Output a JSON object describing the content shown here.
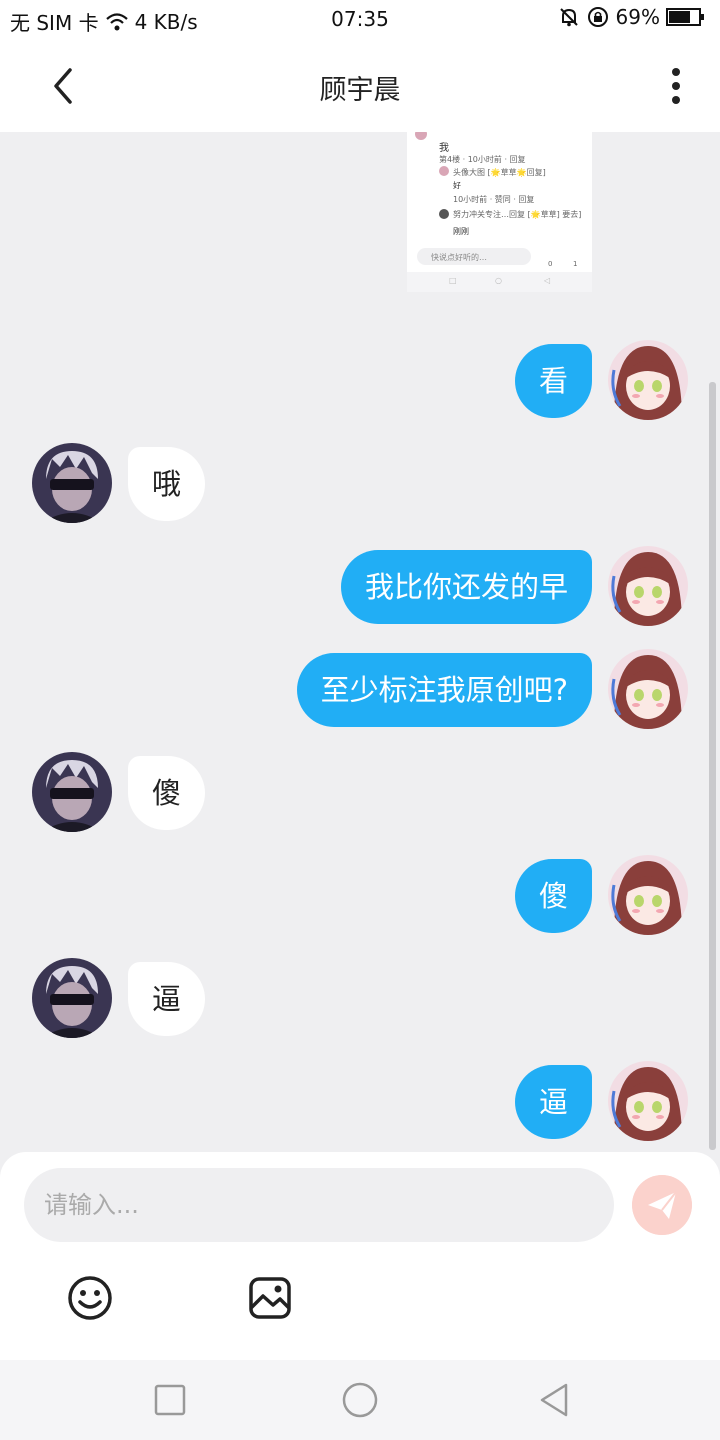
{
  "status_bar": {
    "carrier": "无 SIM 卡",
    "network_speed": "4 KB/s",
    "time": "07:35",
    "battery": "69%",
    "icons": [
      "wifi-icon",
      "mute-bell-icon",
      "rotation-lock-icon",
      "battery-icon"
    ]
  },
  "header": {
    "title": "顾宇晨",
    "back_icon": "chevron-left-icon",
    "more_icon": "more-vertical-icon"
  },
  "shared_screenshot": {
    "lines": [
      "我",
      "第4楼 · 10小时前 · 回复",
      "头像大图 [🌟草草🌟回复]",
      "好",
      "10小时前 · 赞同 · 回复",
      "努力冲关专注…回复 [🌟草草] 要去]",
      "刚刚"
    ],
    "comment_placeholder": "快说点好听的…",
    "counts": [
      "0",
      "1"
    ]
  },
  "messages": [
    {
      "side": "mine",
      "text": "看"
    },
    {
      "side": "theirs",
      "text": "哦"
    },
    {
      "side": "mine",
      "text": "我比你还发的早"
    },
    {
      "side": "mine",
      "text": "至少标注我原创吧?"
    },
    {
      "side": "theirs",
      "text": "傻"
    },
    {
      "side": "mine",
      "text": "傻"
    },
    {
      "side": "theirs",
      "text": "逼"
    },
    {
      "side": "mine",
      "text": "逼"
    }
  ],
  "composer": {
    "placeholder": "请输入...",
    "value": "",
    "send_icon": "send-icon",
    "emoji_icon": "emoji-icon",
    "image_icon": "image-icon"
  },
  "system_nav": {
    "icons": [
      "recent-apps-icon",
      "home-icon",
      "back-triangle-icon"
    ]
  },
  "colors": {
    "my_bubble": "#21aef5",
    "their_bubble": "#ffffff",
    "chat_background": "#efeff1",
    "send_button": "#fbd2cc"
  }
}
